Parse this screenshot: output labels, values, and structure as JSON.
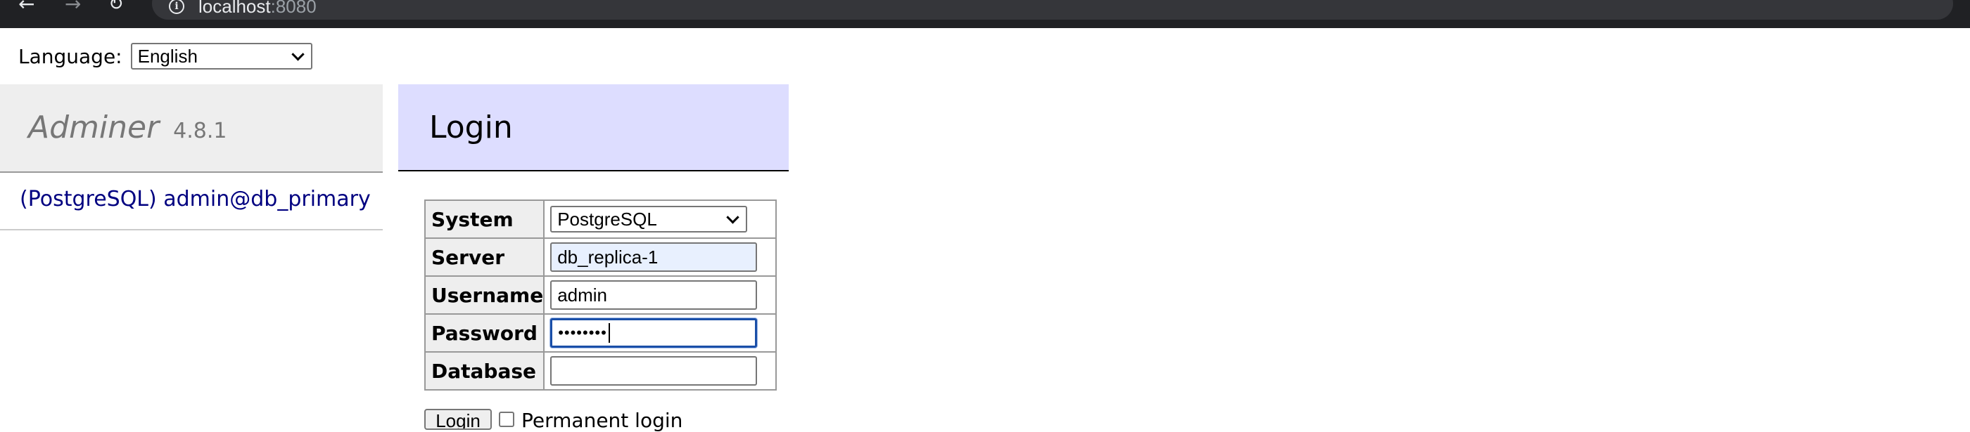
{
  "browser": {
    "url_host": "localhost",
    "url_port": ":8080",
    "icons": {
      "back": "back-arrow-icon",
      "forward": "forward-arrow-icon",
      "reload": "reload-icon",
      "info": "info-icon"
    }
  },
  "language": {
    "label": "Language:",
    "selected": "English"
  },
  "menu": {
    "app_name": "Adminer",
    "version": "4.8.1",
    "db_link": "(PostgreSQL) admin@db_primary"
  },
  "login": {
    "title": "Login",
    "fields": {
      "system": {
        "label": "System",
        "value": "PostgreSQL"
      },
      "server": {
        "label": "Server",
        "value": "db_replica-1"
      },
      "username": {
        "label": "Username",
        "value": "admin"
      },
      "password": {
        "label": "Password",
        "value": "••••••••"
      },
      "database": {
        "label": "Database",
        "value": ""
      }
    },
    "submit_label": "Login",
    "remember_label": "Permanent login"
  },
  "colors": {
    "chrome_bg": "#202124",
    "menu_bg": "#eeeeee",
    "login_header_bg": "#ddddff",
    "link": "#000080",
    "autofill_bg": "#e8f0fe",
    "focus_border": "#1a4fa8"
  }
}
